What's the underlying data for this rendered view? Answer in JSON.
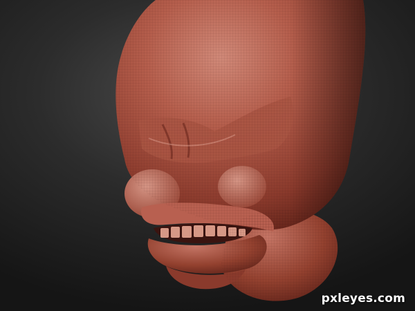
{
  "image": {
    "watermark": "pxleyes.com",
    "colors": {
      "background_light": "#4a4a4a",
      "background_dark": "#151515",
      "clay_highlight": "#d08978",
      "clay_base": "#a04a3a",
      "clay_shadow": "#5a1f16"
    }
  }
}
